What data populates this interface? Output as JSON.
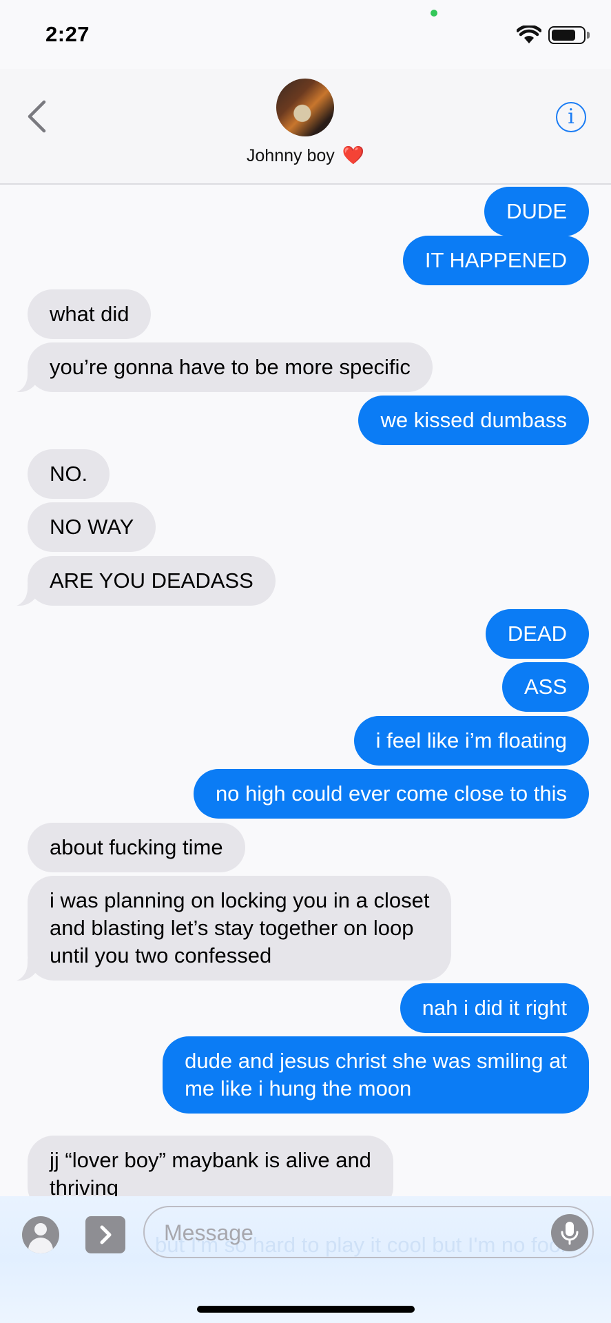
{
  "status_bar": {
    "time": "2:27"
  },
  "header": {
    "contact_name": "Johnny boy",
    "heart": "❤️"
  },
  "messages": [
    {
      "direction": "out",
      "text": "DUDE"
    },
    {
      "direction": "out",
      "text": "IT HAPPENED"
    },
    {
      "direction": "in",
      "text": "what did"
    },
    {
      "direction": "in",
      "text": "you’re gonna have to be more specific"
    },
    {
      "direction": "out",
      "text": "we kissed dumbass"
    },
    {
      "direction": "in",
      "text": "NO."
    },
    {
      "direction": "in",
      "text": "NO WAY"
    },
    {
      "direction": "in",
      "text": "ARE YOU DEADASS"
    },
    {
      "direction": "out",
      "text": "DEAD"
    },
    {
      "direction": "out",
      "text": "ASS"
    },
    {
      "direction": "out",
      "text": "i feel like i’m floating"
    },
    {
      "direction": "out",
      "text": "no high could ever come close to this"
    },
    {
      "direction": "in",
      "text": "about fucking time"
    },
    {
      "direction": "in",
      "lines": [
        "i was planning on locking you in a closet",
        "and blasting let’s stay together on loop",
        "until you two confessed"
      ]
    },
    {
      "direction": "out",
      "text": "nah i did it right"
    },
    {
      "direction": "out",
      "lines": [
        "dude and jesus christ she was smiling at",
        "me like i hung the moon"
      ]
    },
    {
      "direction": "in",
      "lines": [
        "jj “lover boy” maybank is alive and",
        "thriving"
      ]
    }
  ],
  "composer": {
    "placeholder": "Message",
    "ghost_text": "but I'm so hard to play it cool but I'm no fool"
  },
  "colors": {
    "outgoing": "#0b7cf5",
    "incoming": "#e6e5ea",
    "accent": "#1a7cf4"
  }
}
